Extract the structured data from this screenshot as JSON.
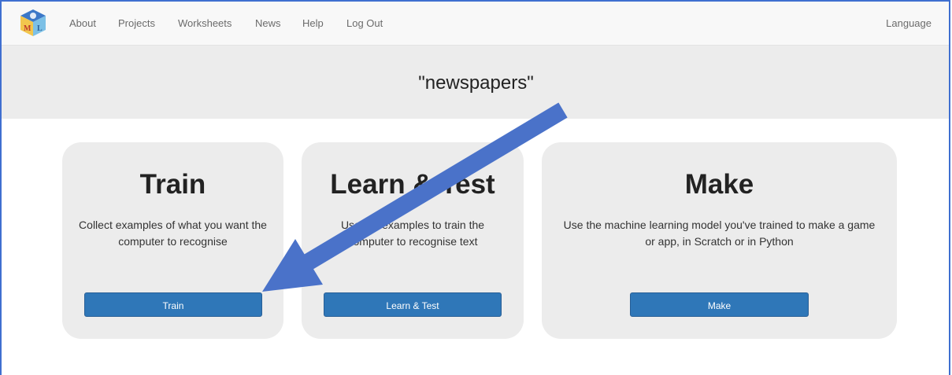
{
  "nav": {
    "logo_letters": "ML",
    "links": [
      "About",
      "Projects",
      "Worksheets",
      "News",
      "Help",
      "Log Out"
    ],
    "language": "Language"
  },
  "banner": {
    "title": "\"newspapers\""
  },
  "cards": [
    {
      "heading": "Train",
      "description": "Collect examples of what you want the computer to recognise",
      "button": "Train"
    },
    {
      "heading": "Learn & Test",
      "description": "Use the examples to train the computer to recognise text",
      "button": "Learn & Test"
    },
    {
      "heading": "Make",
      "description": "Use the machine learning model you've trained to make a game or app, in Scratch or in Python",
      "button": "Make"
    }
  ],
  "colors": {
    "button": "#2f77b8",
    "annotation_arrow": "#4a72c9"
  }
}
